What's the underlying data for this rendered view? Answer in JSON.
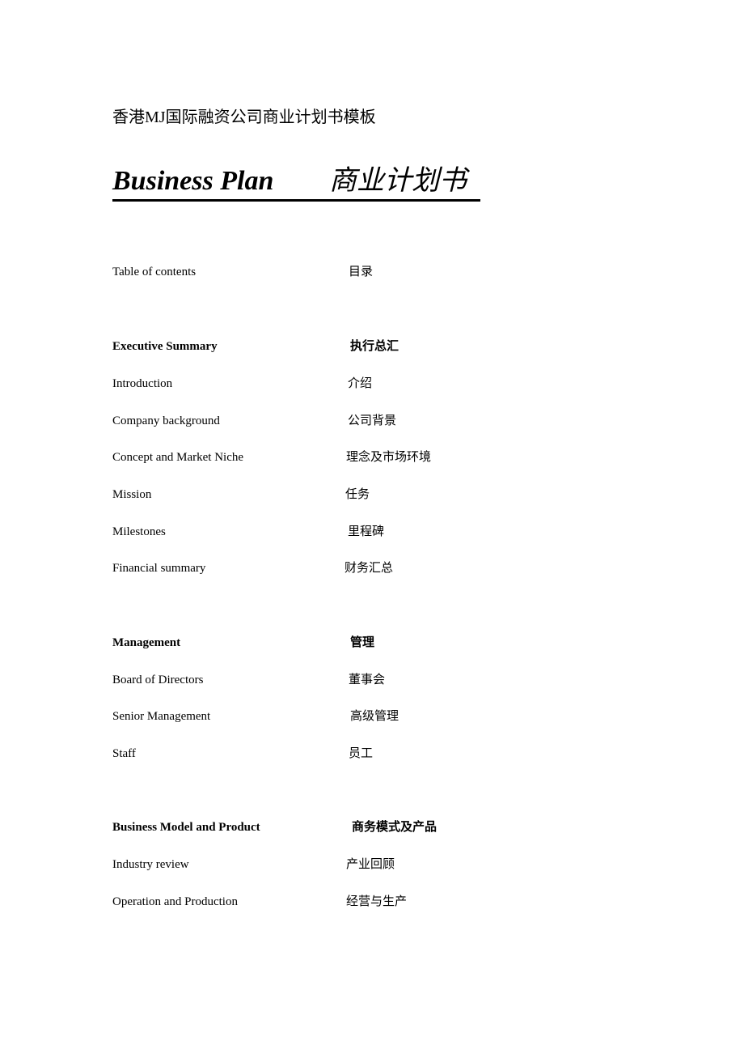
{
  "document": {
    "header_line": "香港MJ国际融资公司商业计划书模板",
    "title_en": "Business Plan",
    "title_zh": "商业计划书"
  },
  "toc": {
    "heading_en": "Table of contents",
    "heading_zh": "目录",
    "sections": [
      {
        "title_en": "Executive Summary",
        "title_zh": "执行总汇",
        "items": [
          {
            "en": "Introduction",
            "zh": "介绍"
          },
          {
            "en": "Company background",
            "zh": "公司背景"
          },
          {
            "en": "Concept and Market Niche",
            "zh": "理念及市场环境"
          },
          {
            "en": "Mission",
            "zh": "任务"
          },
          {
            "en": "Milestones",
            "zh": "里程碑"
          },
          {
            "en": "Financial summary",
            "zh": "财务汇总"
          }
        ]
      },
      {
        "title_en": "Management",
        "title_zh": "管理",
        "items": [
          {
            "en": "Board of Directors",
            "zh": "董事会"
          },
          {
            "en": "Senior Management",
            "zh": "高级管理"
          },
          {
            "en": "Staff",
            "zh": "员工"
          }
        ]
      },
      {
        "title_en": "Business Model and Product",
        "title_zh": "商务模式及产品",
        "items": [
          {
            "en": "Industry review",
            "zh": "产业回顾"
          },
          {
            "en": "Operation and Production",
            "zh": "经营与生产"
          }
        ]
      }
    ]
  }
}
